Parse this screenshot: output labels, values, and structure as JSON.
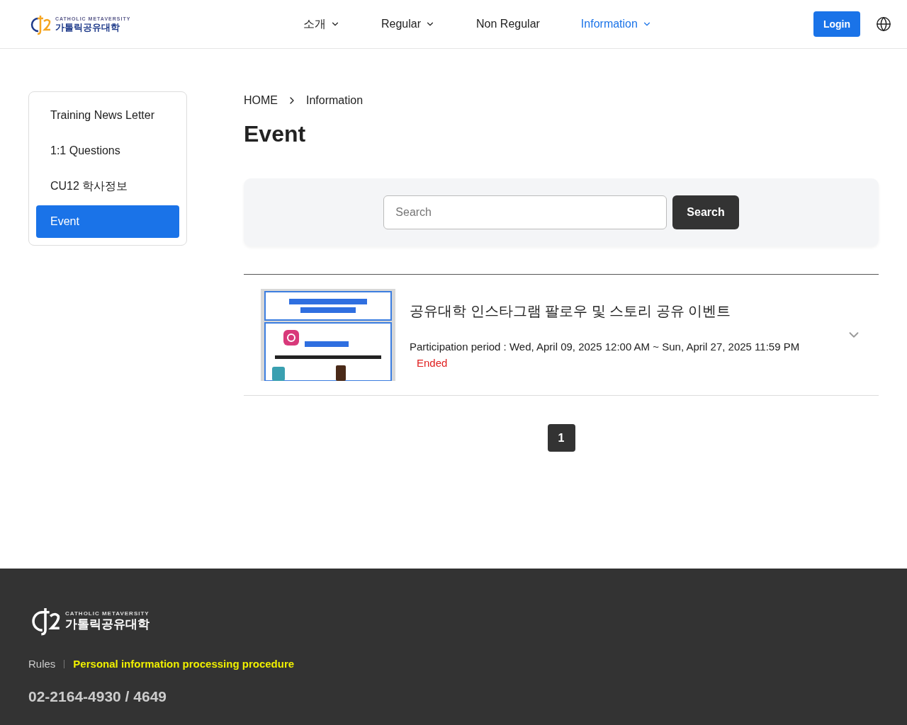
{
  "header": {
    "logo": {
      "tagline": "CATHOLIC METAVERSITY",
      "name": "가톨릭공유대학"
    },
    "nav": [
      {
        "label": "소개",
        "has_menu": true,
        "selected": false
      },
      {
        "label": "Regular",
        "has_menu": true,
        "selected": false
      },
      {
        "label": "Non Regular",
        "has_menu": false,
        "selected": false
      },
      {
        "label": "Information",
        "has_menu": true,
        "selected": true
      }
    ],
    "login": "Login"
  },
  "sidebar": {
    "items": [
      {
        "label": "Training News Letter",
        "selected": false
      },
      {
        "label": "1:1 Questions",
        "selected": false
      },
      {
        "label": "CU12 학사정보",
        "selected": false
      },
      {
        "label": "Event",
        "selected": true
      }
    ]
  },
  "breadcrumb": [
    "HOME",
    "Information"
  ],
  "title": "Event",
  "search": {
    "placeholder": "Search",
    "button": "Search"
  },
  "events": [
    {
      "title": "공유대학 인스타그램 팔로우 및 스토리 공유 이벤트",
      "period": "Participation period : Wed, April 09, 2025 12:00 AM ~ Sun, April 27, 2025 11:59 PM",
      "status": "Ended"
    }
  ],
  "pagination": [
    {
      "label": "1",
      "selected": true
    }
  ],
  "footer": {
    "logo": {
      "tagline": "CATHOLIC METAVERSITY",
      "name": "가톨릭공유대학"
    },
    "links": [
      {
        "label": "Rules",
        "highlighted": false
      },
      {
        "label": "Personal information processing procedure",
        "highlighted": true
      }
    ],
    "phone": "02-2164-4930 / 4649"
  }
}
